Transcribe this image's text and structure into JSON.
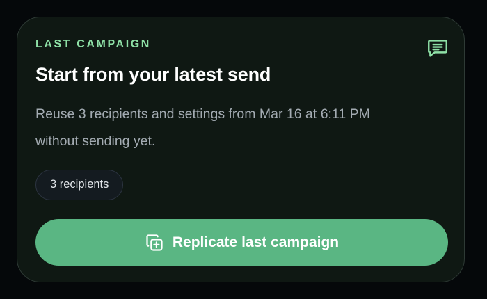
{
  "card": {
    "eyebrow": "LAST CAMPAIGN",
    "message_icon": "message-square-text-icon",
    "title": "Start from your latest send",
    "description": "Reuse 3 recipients and settings from Mar 16 at 6:11 PM without sending yet.",
    "recipients_pill": "3 recipients",
    "cta": {
      "label": "Replicate last campaign",
      "icon": "copy-plus-icon"
    }
  },
  "colors": {
    "background": "#05080a",
    "card_background": "#0f1813",
    "accent_green": "#8ee0a6",
    "button_green": "#5ab683",
    "muted_text": "#a3abb2"
  }
}
